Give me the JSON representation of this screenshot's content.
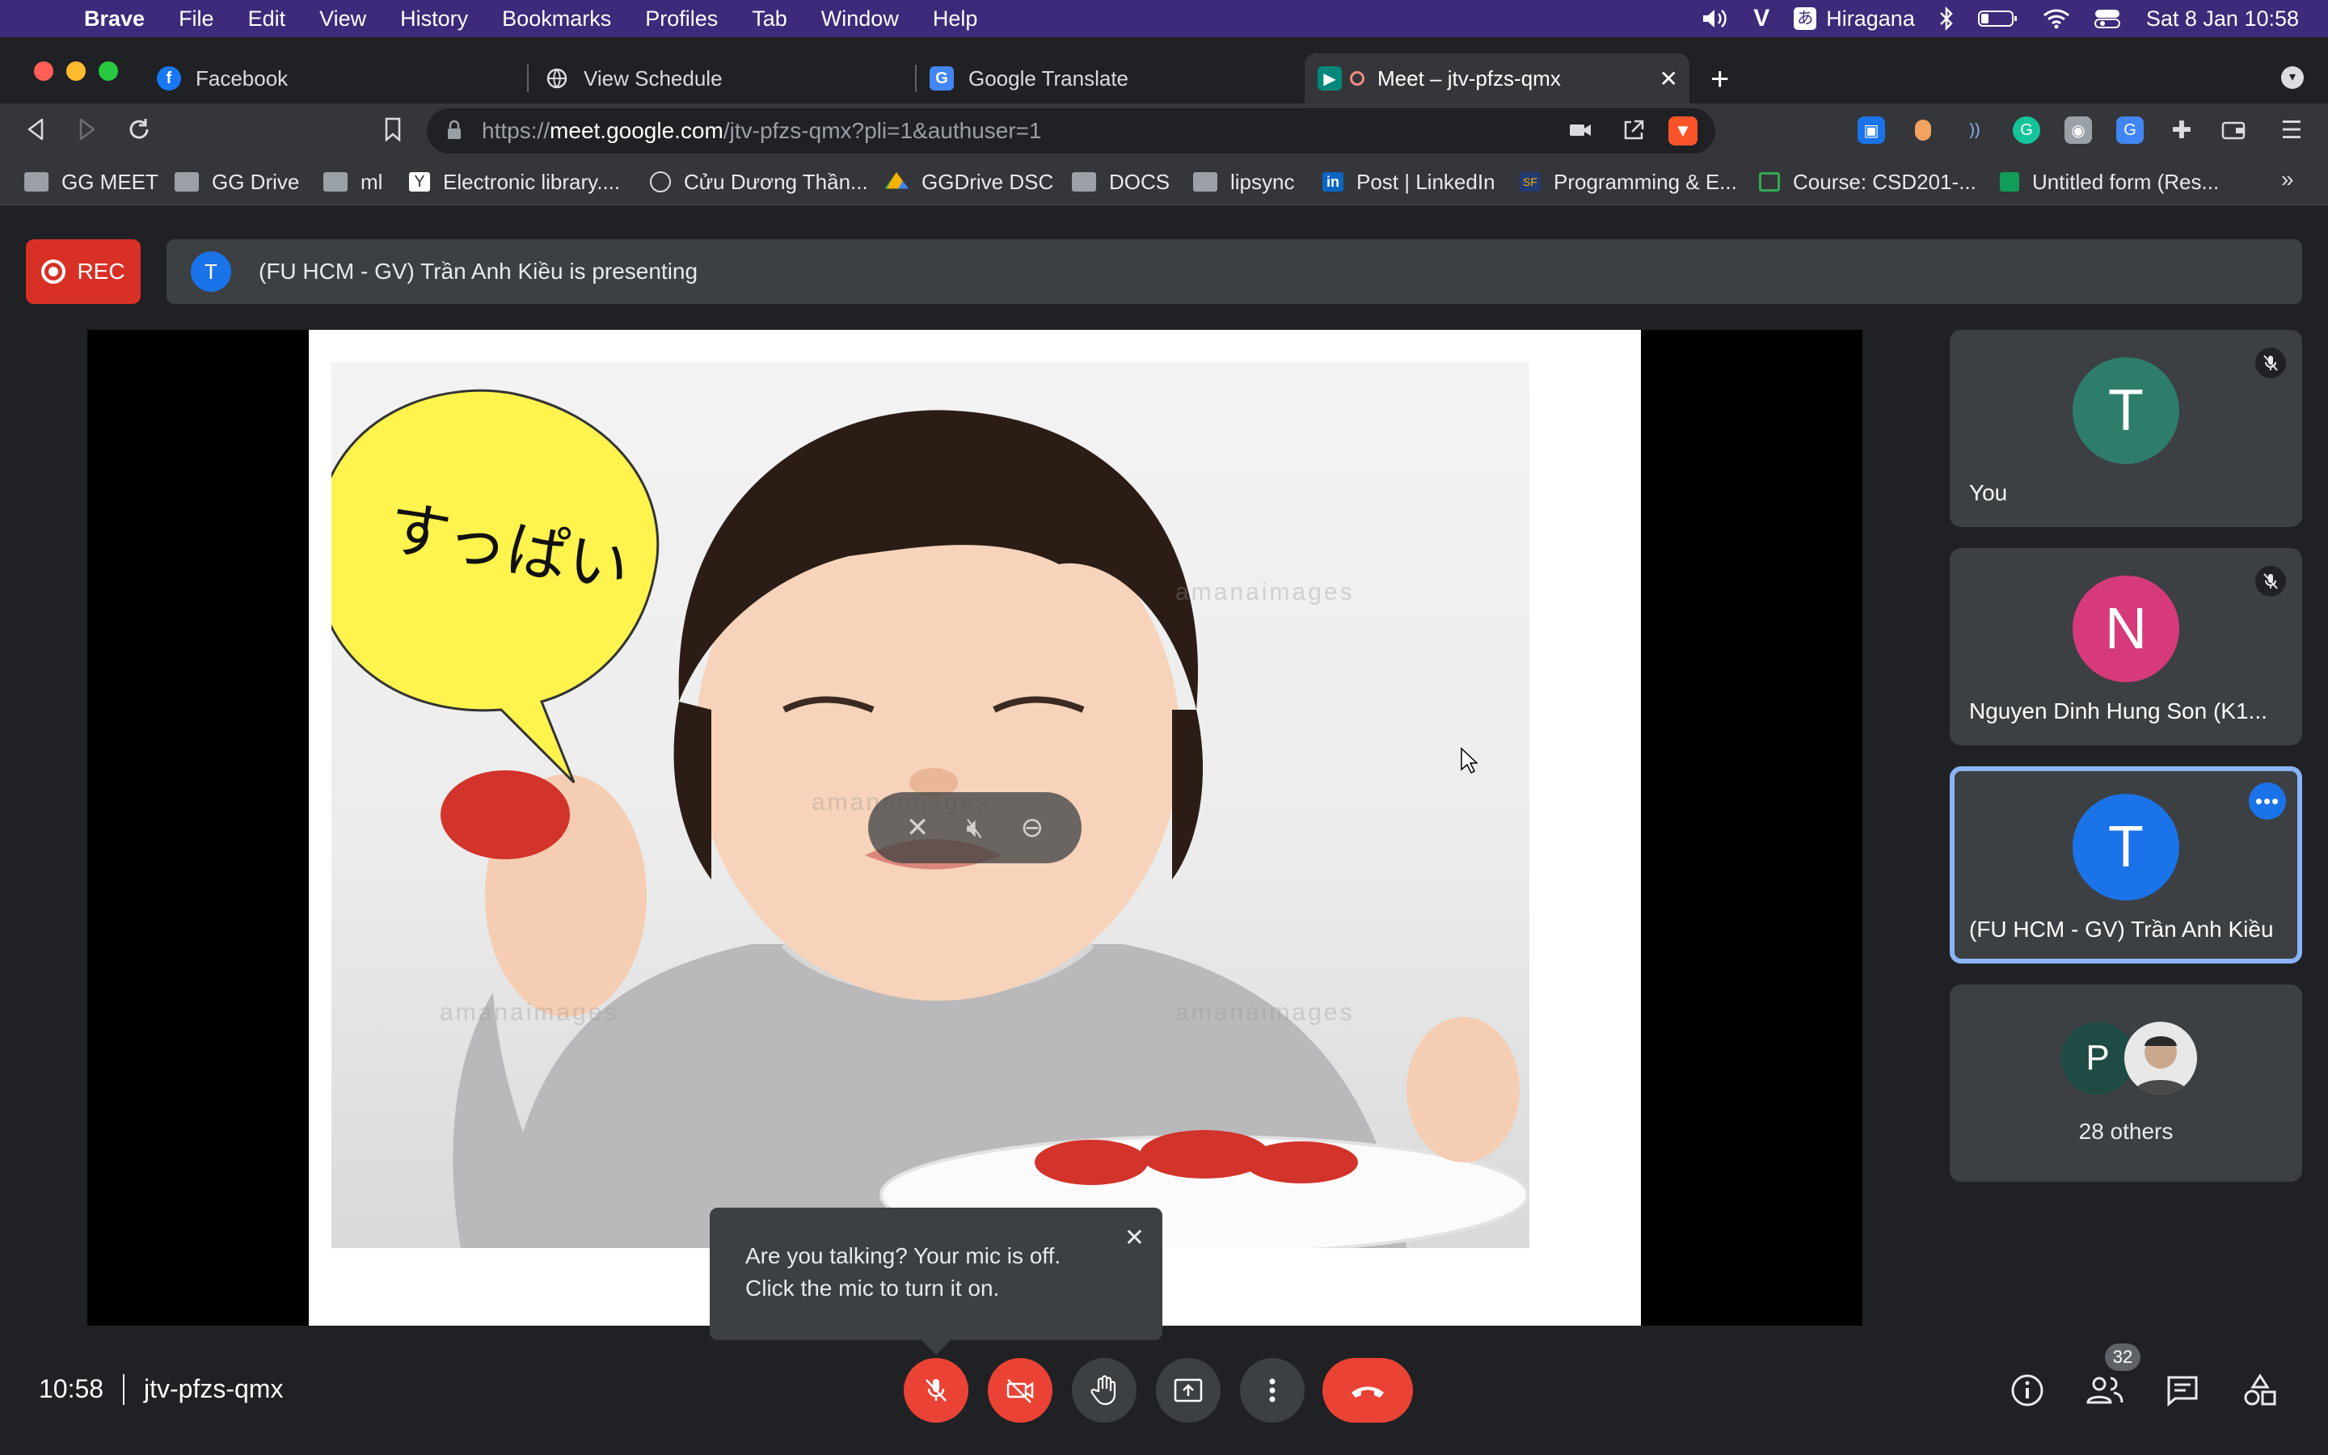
{
  "menubar": {
    "app": "Brave",
    "items": [
      "File",
      "Edit",
      "View",
      "History",
      "Bookmarks",
      "Profiles",
      "Tab",
      "Window",
      "Help"
    ],
    "input_method": "Hiragana",
    "datetime": "Sat 8 Jan  10:58"
  },
  "tabs": [
    {
      "title": "Facebook",
      "favicon": "facebook-icon"
    },
    {
      "title": "View Schedule",
      "favicon": "globe-icon"
    },
    {
      "title": "Google Translate",
      "favicon": "translate-icon"
    },
    {
      "title": "Meet – jtv-pfzs-qmx",
      "favicon": "meet-icon",
      "active": true
    }
  ],
  "address": {
    "scheme": "https://",
    "host": "meet.google.com",
    "path": "/jtv-pfzs-qmx?pli=1&authuser=1"
  },
  "bookmarks": [
    {
      "label": "GG MEET",
      "icon": "folder-icon"
    },
    {
      "label": "GG Drive",
      "icon": "folder-icon"
    },
    {
      "label": "ml",
      "icon": "folder-icon"
    },
    {
      "label": "Electronic library....",
      "icon": "y-icon"
    },
    {
      "label": "Cửu Dương Thần...",
      "icon": "globe-icon"
    },
    {
      "label": "GGDrive DSC",
      "icon": "drive-icon"
    },
    {
      "label": "DOCS",
      "icon": "folder-icon"
    },
    {
      "label": "lipsync",
      "icon": "folder-icon"
    },
    {
      "label": "Post | LinkedIn",
      "icon": "linkedin-icon"
    },
    {
      "label": "Programming & E...",
      "icon": "sf-icon"
    },
    {
      "label": "Course: CSD201-...",
      "icon": "course-icon"
    },
    {
      "label": "Untitled form (Res...",
      "icon": "forms-icon"
    }
  ],
  "meet": {
    "rec_label": "REC",
    "presenter_initial": "T",
    "presenting_text": "(FU HCM - GV) Trần Anh Kiều is presenting",
    "slide_bubble_text": "すっぱい",
    "watermark": "amanaimages",
    "tooltip_text_line1": "Are you talking? Your mic is off.",
    "tooltip_text_line2": "Click the mic to turn it on.",
    "participants": [
      {
        "initial": "T",
        "name": "You",
        "color": "#2e7d6b",
        "muted": true
      },
      {
        "initial": "N",
        "name": "Nguyen Dinh Hung Son (K1...",
        "color": "#d63a7a",
        "muted": true
      },
      {
        "initial": "T",
        "name": "(FU HCM - GV) Trần Anh Kiều",
        "color": "#1a73e8",
        "active": true
      }
    ],
    "others": {
      "initial": "P",
      "label": "28 others"
    },
    "time": "10:58",
    "code": "jtv-pfzs-qmx",
    "people_count": "32"
  }
}
